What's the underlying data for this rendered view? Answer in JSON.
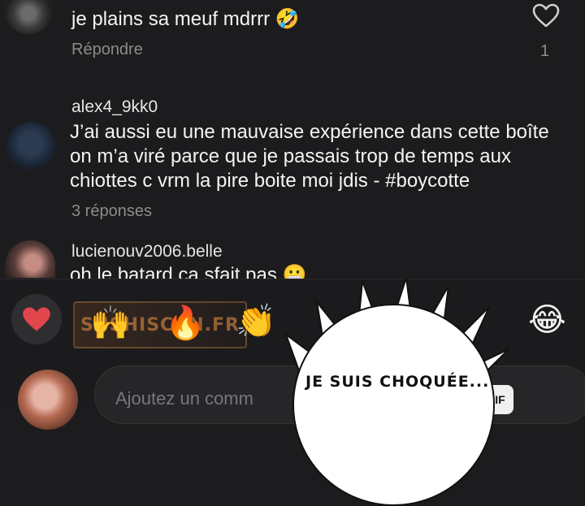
{
  "comments": [
    {
      "text": "je plains sa meuf mdrrr 🤣",
      "reply_label": "Répondre",
      "like_count": "1"
    },
    {
      "username": "alex4_9kk0",
      "lines": [
        "J’ai aussi eu une mauvaise expérience dans cette boîte",
        "on m’a viré parce que je passais trop de temps aux",
        "chiottes c vrm la pire boite moi jdis - #boycotte"
      ],
      "replies_label": "3 réponses"
    },
    {
      "username": "lucienouv2006.belle",
      "text": "oh le batard ca sfait pas 😬"
    }
  ],
  "reactions": {
    "items": [
      "🙌",
      "🔥",
      "👏",
      "😂"
    ]
  },
  "watermark": "SUSHISCAN.FR",
  "composer": {
    "placeholder": "Ajoutez un comm",
    "gif_label": "GIF"
  },
  "speech_bubble": {
    "text": "JE SUIS CHOQUÉE..."
  },
  "colors": {
    "background": "#1c1c1e",
    "heart_red": "#e0464b",
    "muted_text": "#8c8c8c"
  }
}
